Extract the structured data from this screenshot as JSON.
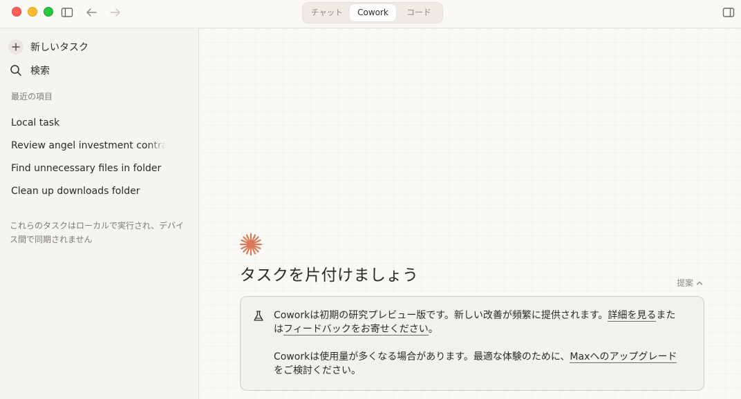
{
  "titlebar": {
    "mode_tabs": [
      {
        "label": "チャット",
        "selected": false
      },
      {
        "label": "Cowork",
        "selected": true
      },
      {
        "label": "コード",
        "selected": false
      }
    ]
  },
  "sidebar": {
    "new_task_label": "新しいタスク",
    "search_label": "検索",
    "recent_header": "最近の項目",
    "recent_items": [
      "Local task",
      "Review angel investment contract",
      "Find unnecessary files in folder",
      "Clean up downloads folder"
    ],
    "footer_note": "これらのタスクはローカルで実行され、デバイス間で同期されません"
  },
  "main": {
    "heading": "タスクを片付けましょう",
    "suggestions_label": "提案",
    "notice": {
      "p1_text_a": "Coworkは初期の研究プレビュー版です。新しい改善が頻繁に提供されます。",
      "p1_link_details": "詳細を見る",
      "p1_text_b": "または",
      "p1_link_feedback": "フィードバックをお寄せください",
      "p1_text_c": "。",
      "p2_text_a": "Coworkは使用量が多くなる場合があります。最適な体験のために、",
      "p2_link_upgrade": "Maxへのアップグレード",
      "p2_text_b": "をご検討ください。"
    }
  },
  "colors": {
    "accent": "#d97757",
    "background": "#faf9f5",
    "sidebar_bg": "#f6f4ef"
  },
  "icons": {
    "sidebar_toggle": "sidebar-toggle-icon",
    "back": "arrow-left-icon",
    "forward": "arrow-right-icon",
    "right_panel": "right-panel-icon",
    "new_task": "plus-icon",
    "search": "search-icon",
    "logo": "asterisk-logo-icon",
    "suggestions": "chevron-up-icon",
    "notice": "flask-icon"
  }
}
